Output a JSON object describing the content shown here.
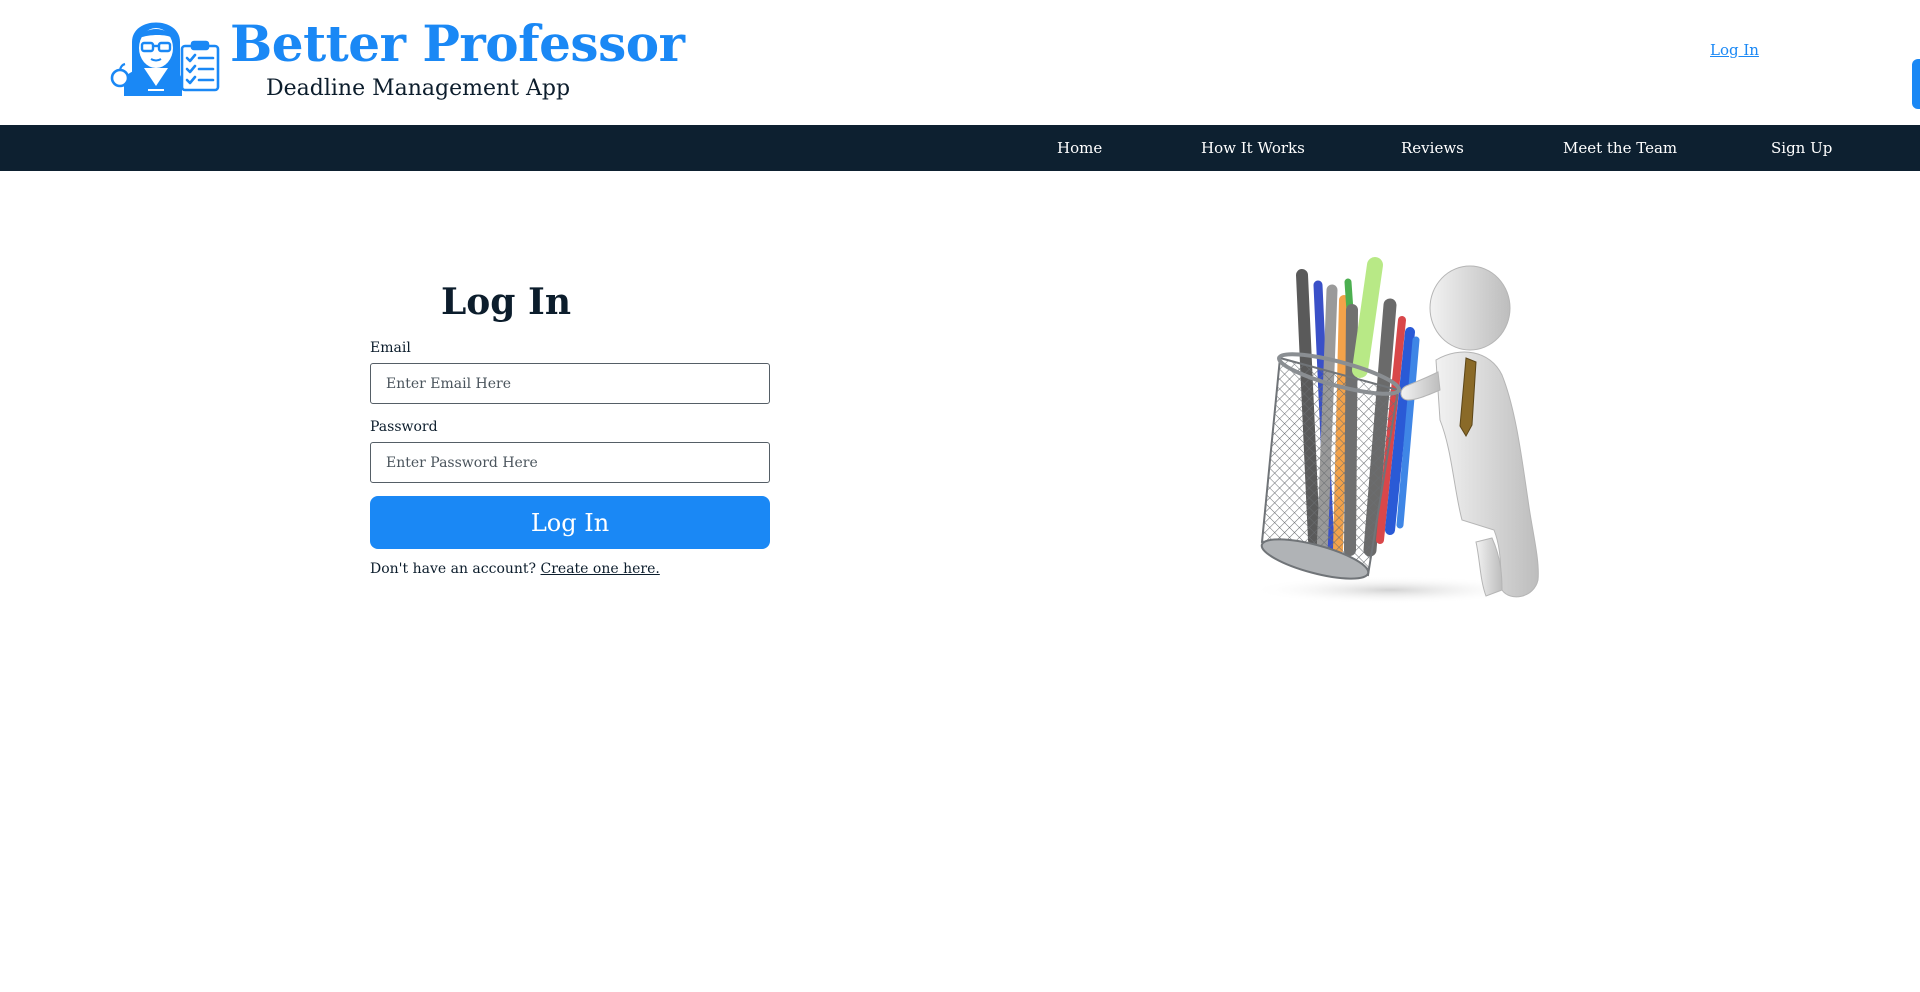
{
  "header": {
    "brand_title": "Better Professor",
    "brand_subtitle": "Deadline Management App",
    "login_link": "Log In",
    "logo_icon": "professor-logo-icon"
  },
  "nav": {
    "items": [
      {
        "label": "Home"
      },
      {
        "label": "How It Works"
      },
      {
        "label": "Reviews"
      },
      {
        "label": "Meet the Team"
      },
      {
        "label": "Sign Up"
      }
    ]
  },
  "login_form": {
    "title": "Log In",
    "email": {
      "label": "Email",
      "placeholder": "Enter Email Here",
      "value": ""
    },
    "password": {
      "label": "Password",
      "placeholder": "Enter Password Here",
      "value": ""
    },
    "submit_label": "Log In",
    "signup_prompt": "Don't have an account?",
    "signup_link": "Create one here."
  },
  "illustration": {
    "icon": "figure-with-pencil-cup-icon"
  },
  "colors": {
    "accent": "#1a88f5",
    "nav_background": "#0d2030",
    "text": "#0c1d2c",
    "background": "#ffffff"
  }
}
